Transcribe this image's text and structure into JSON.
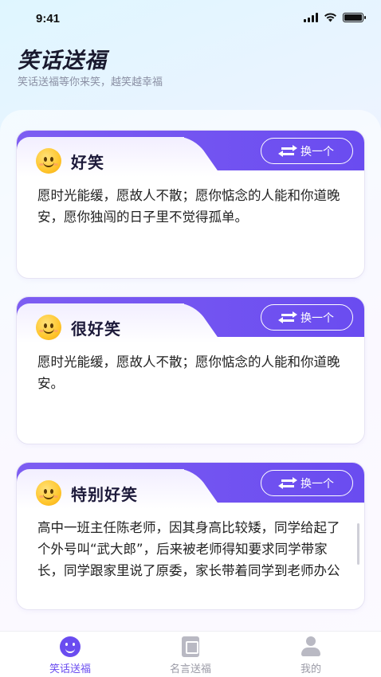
{
  "status_bar": {
    "time": "9:41"
  },
  "header": {
    "title": "笑话送福",
    "subtitle": "笑话送福等你来笑，越笑越幸福"
  },
  "cards": [
    {
      "title": "好笑",
      "swap_label": "换一个",
      "text": "愿时光能缓，愿故人不散；愿你惦念的人能和你道晚安，愿你独闯的日子里不觉得孤单。"
    },
    {
      "title": "很好笑",
      "swap_label": "换一个",
      "text": "愿时光能缓，愿故人不散；愿你惦念的人能和你道晚安。"
    },
    {
      "title": "特别好笑",
      "swap_label": "换一个",
      "text": "高中一班主任陈老师，因其身高比较矮，同学给起了个外号叫“武大郎”，后来被老师得知要求同学带家长，同学跟家里说了原委，家长带着同学到老师办公室致歉该"
    }
  ],
  "tabbar": {
    "items": [
      {
        "label": "笑话送福",
        "icon": "smile-icon",
        "active": true
      },
      {
        "label": "名言送福",
        "icon": "book-icon",
        "active": false
      },
      {
        "label": "我的",
        "icon": "user-icon",
        "active": false
      }
    ]
  },
  "colors": {
    "accent": "#6a4cf0",
    "tab_inactive": "#9a9aa6"
  }
}
